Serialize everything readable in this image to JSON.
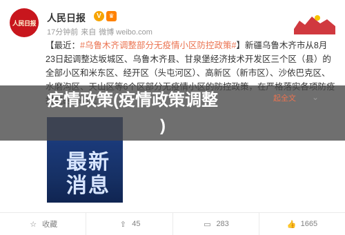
{
  "header": {
    "logo_text": "人民日报",
    "author": "人民日报",
    "verified_badge": "V",
    "meta_time": "17分钟前",
    "meta_from": "来自",
    "meta_source": "微博 weibo.com"
  },
  "post": {
    "prefix": "【最近：",
    "tag": "#乌鲁木齐调整部分无疫情小区防控政策#",
    "text": "】新疆乌鲁木齐市从8月23日起调整达坂城区、乌鲁木齐县、甘泉堡经济技术开发区三个区（县）的全部小区和米东区、经开区（头屯河区）、高新区（新市区）、沙依巴克区、水磨沟区、天山区等6个区部分无疫情小区的防控政策，在严格落实各项防疫措施的基础上，"
  },
  "overlay": {
    "title_line1": "疫情政策(疫情政策调整",
    "title_line2": ")",
    "more_link": "起全文",
    "chevron": "⌄"
  },
  "poster": {
    "logo": "人民日报",
    "big1": "最新",
    "big2": "消息"
  },
  "actions": [
    {
      "icon": "star-icon",
      "glyph": "☆",
      "label": "收藏"
    },
    {
      "icon": "repost-icon",
      "glyph": "⇪",
      "label": "45"
    },
    {
      "icon": "comment-icon",
      "glyph": "▭",
      "label": "283"
    },
    {
      "icon": "like-icon",
      "glyph": "👍",
      "label": "1665"
    }
  ]
}
